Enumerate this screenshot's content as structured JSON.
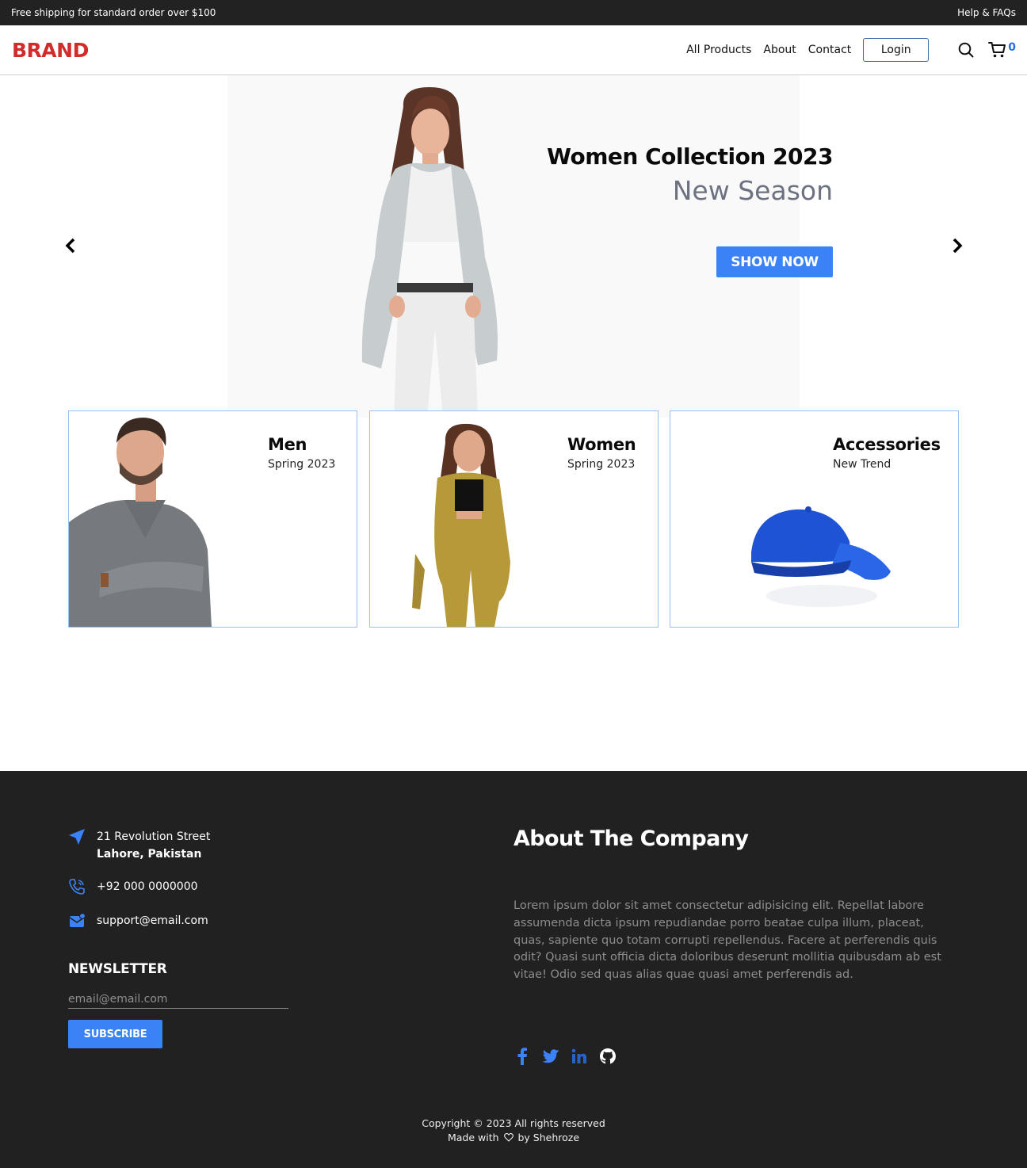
{
  "topbar": {
    "shipping_text": "Free shipping for standard order over $100",
    "help_link": "Help & FAQs"
  },
  "header": {
    "brand": "BRAND",
    "nav": [
      "All Products",
      "About",
      "Contact"
    ],
    "login_label": "Login",
    "cart_count": "0",
    "icons": [
      "search-icon",
      "cart-icon"
    ]
  },
  "hero": {
    "title": "Women Collection 2023",
    "subtitle": "New Season",
    "button_label": "SHOW NOW",
    "icons": [
      "chevron-left-icon",
      "chevron-right-icon"
    ]
  },
  "categories": [
    {
      "title": "Men",
      "subtitle": "Spring 2023"
    },
    {
      "title": "Women",
      "subtitle": "Spring 2023"
    },
    {
      "title": "Accessories",
      "subtitle": "New Trend"
    }
  ],
  "footer": {
    "address_line1": "21 Revolution Street",
    "address_line2": "Lahore, Pakistan",
    "phone": "+92 000 0000000",
    "email": "support@email.com",
    "newsletter_title": "NEWSLETTER",
    "newsletter_placeholder": "email@email.com",
    "subscribe_label": "SUBSCRIBE",
    "about_title": "About The Company",
    "about_text": "Lorem ipsum dolor sit amet consectetur adipisicing elit. Repellat labore assumenda dicta ipsum repudiandae porro beatae culpa illum, placeat, quas, sapiente quo totam corrupti repellendus. Facere at perferendis quis odit? Quasi sunt officia dicta doloribus deserunt mollitia quibusdam ab est vitae! Odio sed quas alias quae quasi amet perferendis ad.",
    "copyright": "Copyright © 2023 All rights reserved",
    "made_with_prefix": "Made with",
    "made_with_suffix": "by Shehroze",
    "social_icons": [
      "facebook-icon",
      "twitter-icon",
      "linkedin-icon",
      "github-icon"
    ]
  },
  "colors": {
    "accent": "#3b82f6",
    "brand": "#d22b2b",
    "dark": "#212121"
  }
}
